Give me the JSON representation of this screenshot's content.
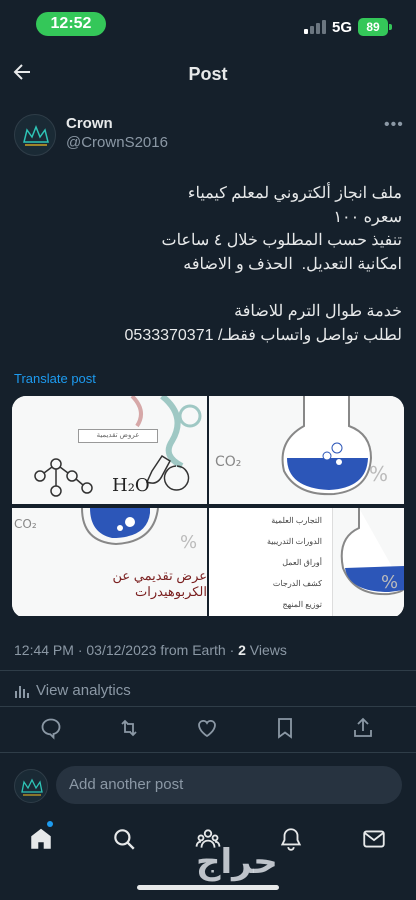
{
  "status": {
    "time": "12:52",
    "network": "5G",
    "battery": "89"
  },
  "header": {
    "title": "Post"
  },
  "author": {
    "name": "Crown",
    "handle": "@CrownS2016"
  },
  "post": {
    "lines_block1": [
      "ملف انجاز ألكتروني لمعلم كيمياء",
      "سعره ١٠٠",
      "تنفيذ حسب المطلوب خلال ٤ ساعات",
      "امكانية التعديل.  الحذف و الاضافه"
    ],
    "lines_block2": [
      "خدمة طوال الترم للاضافة",
      "لطلب تواصل واتساب فقطـ/ 0533370371"
    ],
    "translate": "Translate post"
  },
  "media": {
    "tile1_label": "عروض تقديمية",
    "tile3_caption": "عرض تقديمي عن الكربوهيدرات",
    "tile4_items": [
      "التجارب العلمية",
      "الدورات التدريبية",
      "أوراق العمل",
      "كشف الدرجات",
      "توزيع المنهج"
    ]
  },
  "meta": {
    "timestamp": "12:44 PM · 03/12/2023 from Earth · ",
    "views_count": "2",
    "views_label": " Views"
  },
  "analytics": {
    "label": "View analytics"
  },
  "reply": {
    "placeholder": "Add another post"
  },
  "watermark": "حراج",
  "colors": {
    "background": "#15202b",
    "accent": "#1d9bf0",
    "status_green": "#34c759",
    "muted": "#8b98a5"
  }
}
